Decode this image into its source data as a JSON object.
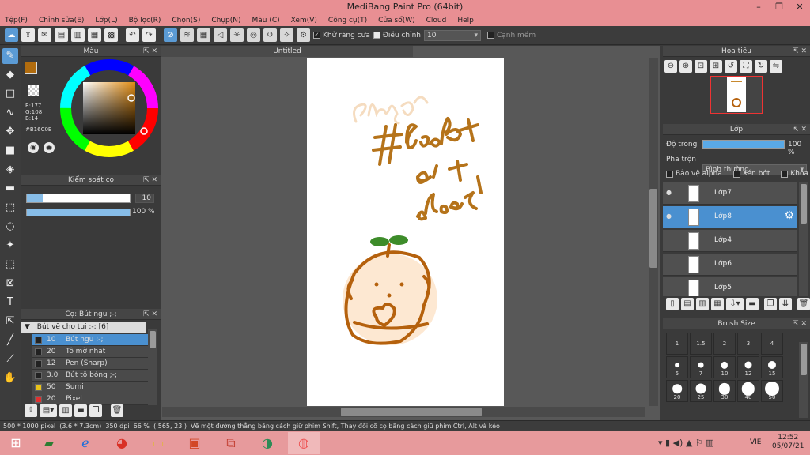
{
  "title": "MediBang Paint Pro (64bit)",
  "window_controls": [
    "–",
    "❐",
    "✕"
  ],
  "menu": [
    "Tệp(F)",
    "Chỉnh sửa(E)",
    "Lớp(L)",
    "Bộ lọc(R)",
    "Chọn(S)",
    "Chụp(N)",
    "Màu (C)",
    "Xem(V)",
    "Công cụ(T)",
    "Cửa sổ(W)",
    "Cloud",
    "Help"
  ],
  "toolbar": {
    "antialias_label": "Khử răng cưa",
    "adjust_label": "Điều chỉnh",
    "adjust_value": "10",
    "soft_edge_label": "Cạnh mềm"
  },
  "color_panel": {
    "title": "Màu",
    "r": "R:177",
    "g": "G:108",
    "b": "B:14",
    "hex": "#B16C0E",
    "main_color": "#B16C0E"
  },
  "brush_control": {
    "title": "Kiểm soát cọ",
    "size_value": "10",
    "opacity_value": "100 %",
    "size_fraction": 0.15,
    "opacity_fraction": 1.0
  },
  "brush_list": {
    "title": "Cọ: Bút ngu ;-;",
    "group_label": "Bút vẽ cho tui ;-; [6]",
    "items": [
      {
        "size": "10",
        "name": "Bút ngu ;-;",
        "color": "#222222"
      },
      {
        "size": "20",
        "name": "Tô mờ nhạt",
        "color": "#222222"
      },
      {
        "size": "12",
        "name": "Pen (Sharp)",
        "color": "#222222"
      },
      {
        "size": "3.0",
        "name": "Bút tô bóng ;-;",
        "color": "#222222"
      },
      {
        "size": "50",
        "name": "Sumi",
        "color": "#e8c21a"
      },
      {
        "size": "20",
        "name": "Pixel",
        "color": "#e03030"
      }
    ]
  },
  "canvas": {
    "tab": "Untitled"
  },
  "navigator": {
    "title": "Hoa tiêu"
  },
  "layers": {
    "title": "Lớp",
    "opacity_label": "Độ trong",
    "opacity_value": "100 %",
    "opacity_fraction": 1.0,
    "blend_label": "Pha trộn",
    "blend_value": "Bình thường",
    "protect_alpha": "Bảo vệ alpha",
    "clipping": "Xén bớt",
    "lock": "Khóa",
    "items": [
      {
        "name": "Lớp7",
        "visible": true,
        "selected": false
      },
      {
        "name": "Lớp8",
        "visible": true,
        "selected": true
      },
      {
        "name": "Lớp4",
        "visible": false,
        "selected": false
      },
      {
        "name": "Lớp6",
        "visible": false,
        "selected": false
      },
      {
        "name": "Lớp5",
        "visible": false,
        "selected": false
      }
    ]
  },
  "brush_size": {
    "title": "Brush Size",
    "sizes": [
      "1",
      "1.5",
      "2",
      "3",
      "4",
      "5",
      "7",
      "10",
      "12",
      "15",
      "20",
      "25",
      "30",
      "40",
      "50"
    ]
  },
  "status": {
    "dims": "500 * 1000 pixel",
    "cm": "(3.6 * 7.3cm)",
    "dpi": "350 dpi",
    "zoom": "66 %",
    "coords": "( 565, 23 )",
    "hint": "Vẽ một đường thẳng bằng cách giữ phím Shift, Thay đổi cỡ cọ bằng cách giữ phím Ctrl, Alt và kéo"
  },
  "taskbar": {
    "time": "12:52",
    "date": "05/07/21",
    "lang": "VIE"
  }
}
